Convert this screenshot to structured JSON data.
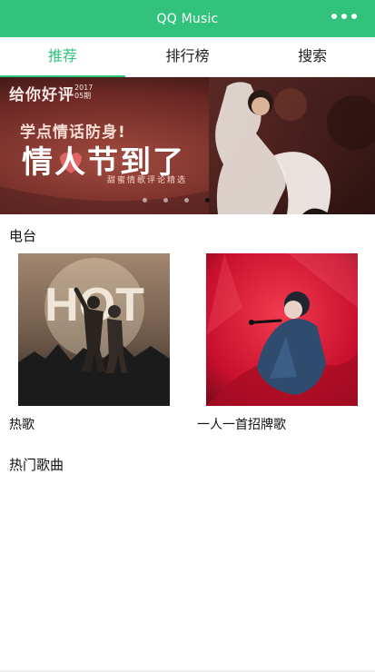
{
  "header": {
    "title": "QQ Music",
    "menu_icon": "more-dots-icon",
    "background": "#31c27c"
  },
  "tabs": [
    {
      "label": "推荐",
      "active": true
    },
    {
      "label": "排行榜",
      "active": false
    },
    {
      "label": "搜索",
      "active": false
    }
  ],
  "banner": {
    "brand": "给你好评",
    "issue_year": "2017",
    "issue_no": "05期",
    "subtitle": "学点情话防身!",
    "headline": "情人节到了",
    "tagline": "甜蜜情歌评论精选",
    "slides_total": 4,
    "slide_active_index": 3
  },
  "radio": {
    "title": "电台",
    "items": [
      {
        "label": "热歌",
        "cover_text": "HOT",
        "cover_icon": "concert-crowd-cover"
      },
      {
        "label": "一人一首招牌歌",
        "cover_icon": "singer-red-cover"
      }
    ]
  },
  "hot_songs": {
    "title": "热门歌曲"
  },
  "colors": {
    "accent": "#31c27c",
    "text": "#111111"
  }
}
